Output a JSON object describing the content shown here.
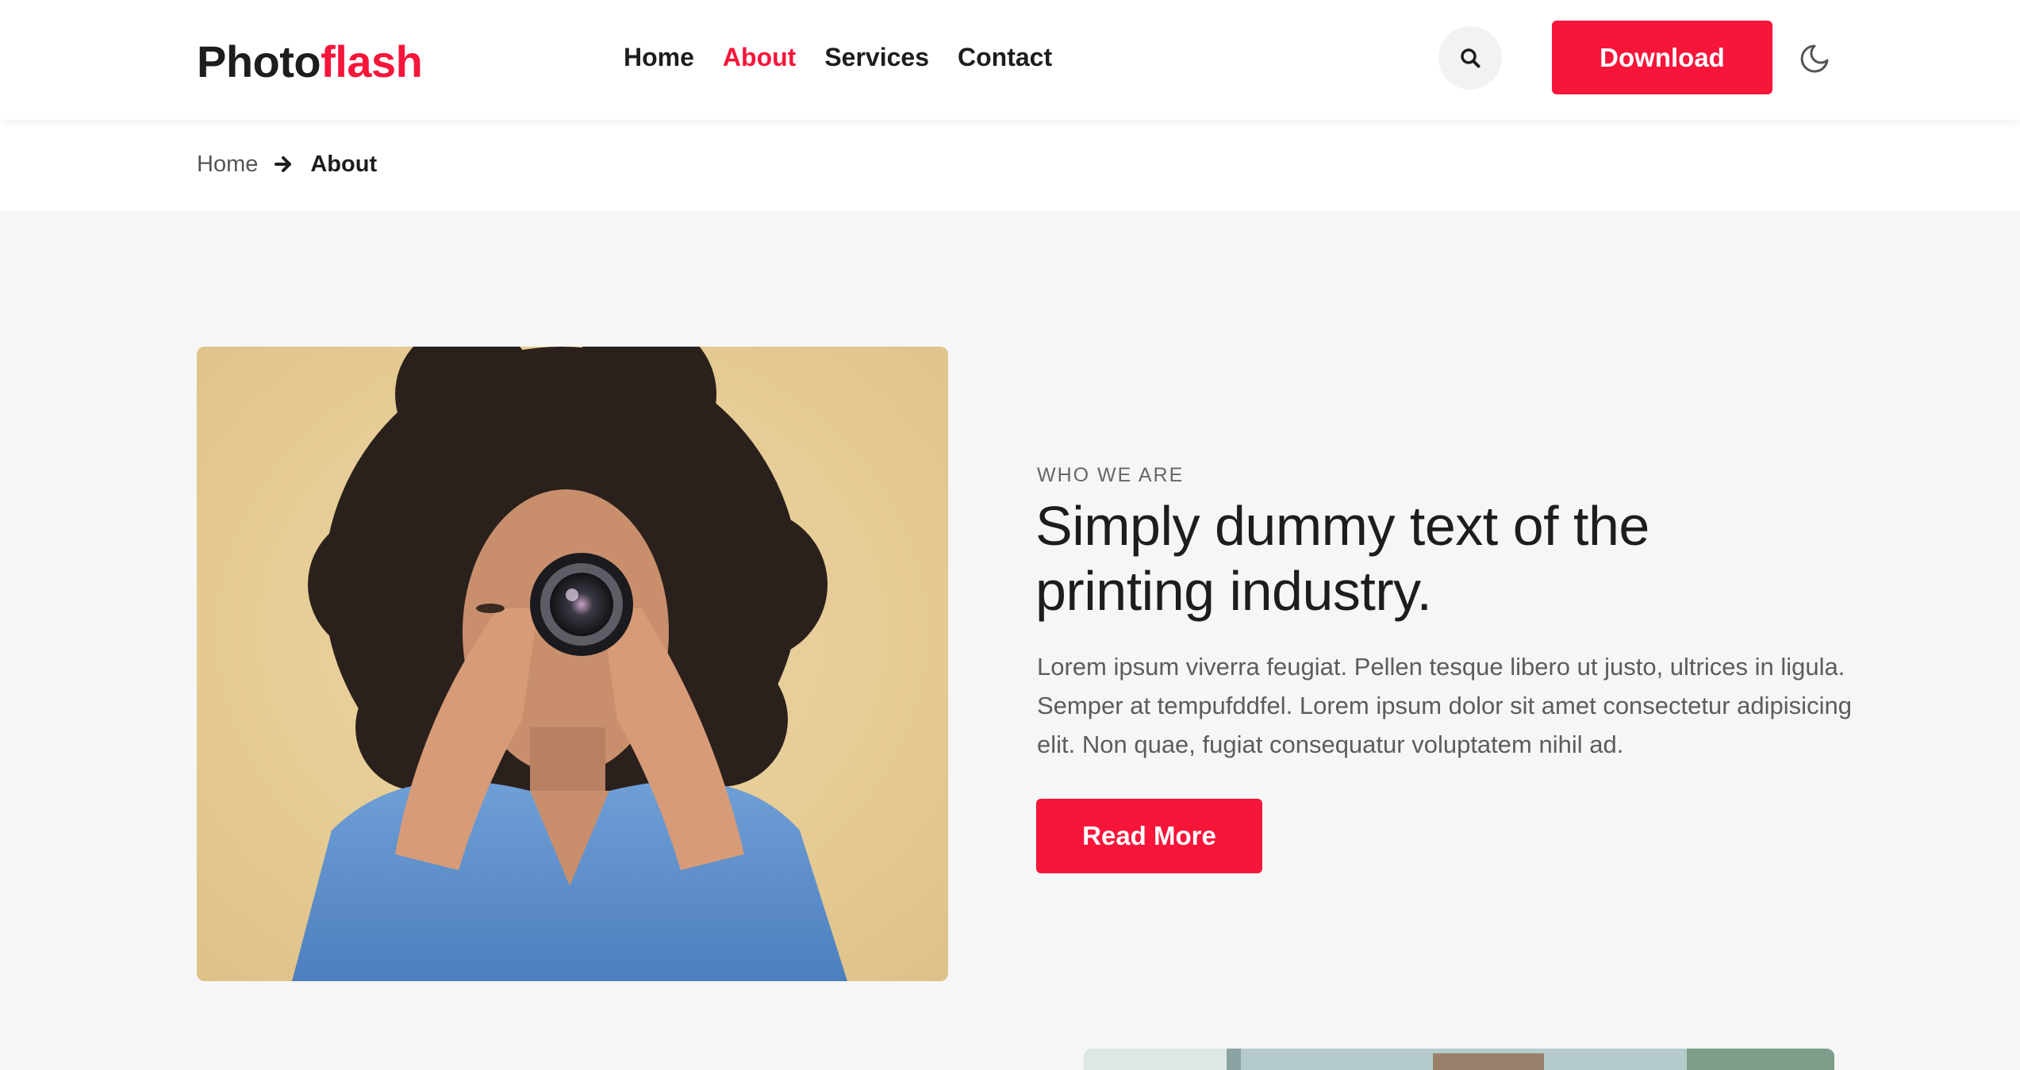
{
  "header": {
    "logo": {
      "part1": "Photo",
      "part2": "flash"
    },
    "nav": [
      {
        "label": "Home",
        "active": false
      },
      {
        "label": "About",
        "active": true
      },
      {
        "label": "Services",
        "active": false
      },
      {
        "label": "Contact",
        "active": false
      }
    ],
    "search_icon": "search-icon",
    "download_label": "Download",
    "theme_icon": "moon-icon"
  },
  "breadcrumb": {
    "home": "Home",
    "separator_icon": "arrow-right-icon",
    "current": "About"
  },
  "about": {
    "eyebrow": "WHO WE ARE",
    "headline": "Simply dummy text of the printing industry.",
    "body": "Lorem ipsum viverra feugiat. Pellen tesque libero ut justo, ultrices in ligula. Semper at tempufddfel. Lorem ipsum dolor sit amet consectetur adipisicing elit. Non quae, fugiat consequatur voluptatem nihil ad.",
    "cta_label": "Read More"
  },
  "colors": {
    "accent": "#f7153a",
    "text": "#1d1d1d",
    "page_bg": "#f6f6f6"
  }
}
